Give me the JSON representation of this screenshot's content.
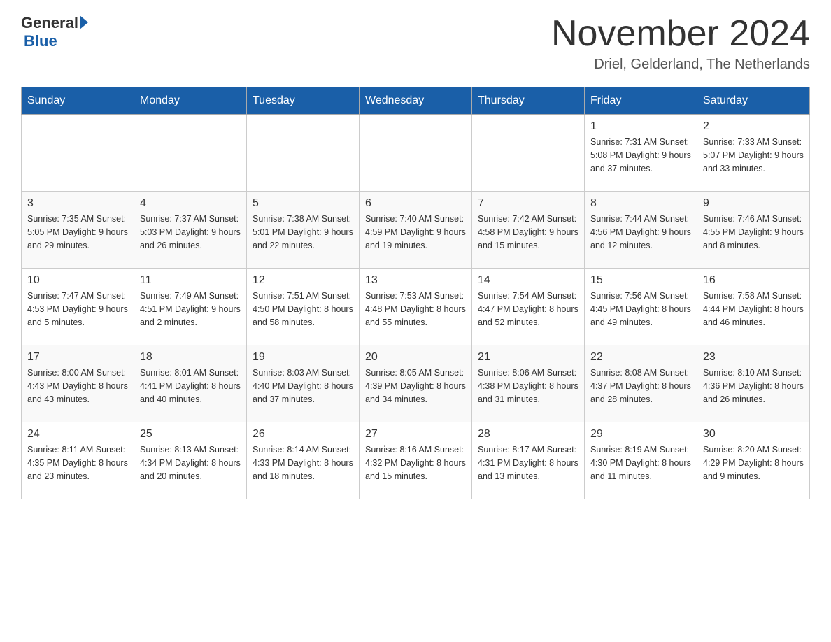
{
  "header": {
    "logo_general": "General",
    "logo_blue": "Blue",
    "month_title": "November 2024",
    "location": "Driel, Gelderland, The Netherlands"
  },
  "weekdays": [
    "Sunday",
    "Monday",
    "Tuesday",
    "Wednesday",
    "Thursday",
    "Friday",
    "Saturday"
  ],
  "weeks": [
    [
      {
        "day": "",
        "info": ""
      },
      {
        "day": "",
        "info": ""
      },
      {
        "day": "",
        "info": ""
      },
      {
        "day": "",
        "info": ""
      },
      {
        "day": "",
        "info": ""
      },
      {
        "day": "1",
        "info": "Sunrise: 7:31 AM\nSunset: 5:08 PM\nDaylight: 9 hours\nand 37 minutes."
      },
      {
        "day": "2",
        "info": "Sunrise: 7:33 AM\nSunset: 5:07 PM\nDaylight: 9 hours\nand 33 minutes."
      }
    ],
    [
      {
        "day": "3",
        "info": "Sunrise: 7:35 AM\nSunset: 5:05 PM\nDaylight: 9 hours\nand 29 minutes."
      },
      {
        "day": "4",
        "info": "Sunrise: 7:37 AM\nSunset: 5:03 PM\nDaylight: 9 hours\nand 26 minutes."
      },
      {
        "day": "5",
        "info": "Sunrise: 7:38 AM\nSunset: 5:01 PM\nDaylight: 9 hours\nand 22 minutes."
      },
      {
        "day": "6",
        "info": "Sunrise: 7:40 AM\nSunset: 4:59 PM\nDaylight: 9 hours\nand 19 minutes."
      },
      {
        "day": "7",
        "info": "Sunrise: 7:42 AM\nSunset: 4:58 PM\nDaylight: 9 hours\nand 15 minutes."
      },
      {
        "day": "8",
        "info": "Sunrise: 7:44 AM\nSunset: 4:56 PM\nDaylight: 9 hours\nand 12 minutes."
      },
      {
        "day": "9",
        "info": "Sunrise: 7:46 AM\nSunset: 4:55 PM\nDaylight: 9 hours\nand 8 minutes."
      }
    ],
    [
      {
        "day": "10",
        "info": "Sunrise: 7:47 AM\nSunset: 4:53 PM\nDaylight: 9 hours\nand 5 minutes."
      },
      {
        "day": "11",
        "info": "Sunrise: 7:49 AM\nSunset: 4:51 PM\nDaylight: 9 hours\nand 2 minutes."
      },
      {
        "day": "12",
        "info": "Sunrise: 7:51 AM\nSunset: 4:50 PM\nDaylight: 8 hours\nand 58 minutes."
      },
      {
        "day": "13",
        "info": "Sunrise: 7:53 AM\nSunset: 4:48 PM\nDaylight: 8 hours\nand 55 minutes."
      },
      {
        "day": "14",
        "info": "Sunrise: 7:54 AM\nSunset: 4:47 PM\nDaylight: 8 hours\nand 52 minutes."
      },
      {
        "day": "15",
        "info": "Sunrise: 7:56 AM\nSunset: 4:45 PM\nDaylight: 8 hours\nand 49 minutes."
      },
      {
        "day": "16",
        "info": "Sunrise: 7:58 AM\nSunset: 4:44 PM\nDaylight: 8 hours\nand 46 minutes."
      }
    ],
    [
      {
        "day": "17",
        "info": "Sunrise: 8:00 AM\nSunset: 4:43 PM\nDaylight: 8 hours\nand 43 minutes."
      },
      {
        "day": "18",
        "info": "Sunrise: 8:01 AM\nSunset: 4:41 PM\nDaylight: 8 hours\nand 40 minutes."
      },
      {
        "day": "19",
        "info": "Sunrise: 8:03 AM\nSunset: 4:40 PM\nDaylight: 8 hours\nand 37 minutes."
      },
      {
        "day": "20",
        "info": "Sunrise: 8:05 AM\nSunset: 4:39 PM\nDaylight: 8 hours\nand 34 minutes."
      },
      {
        "day": "21",
        "info": "Sunrise: 8:06 AM\nSunset: 4:38 PM\nDaylight: 8 hours\nand 31 minutes."
      },
      {
        "day": "22",
        "info": "Sunrise: 8:08 AM\nSunset: 4:37 PM\nDaylight: 8 hours\nand 28 minutes."
      },
      {
        "day": "23",
        "info": "Sunrise: 8:10 AM\nSunset: 4:36 PM\nDaylight: 8 hours\nand 26 minutes."
      }
    ],
    [
      {
        "day": "24",
        "info": "Sunrise: 8:11 AM\nSunset: 4:35 PM\nDaylight: 8 hours\nand 23 minutes."
      },
      {
        "day": "25",
        "info": "Sunrise: 8:13 AM\nSunset: 4:34 PM\nDaylight: 8 hours\nand 20 minutes."
      },
      {
        "day": "26",
        "info": "Sunrise: 8:14 AM\nSunset: 4:33 PM\nDaylight: 8 hours\nand 18 minutes."
      },
      {
        "day": "27",
        "info": "Sunrise: 8:16 AM\nSunset: 4:32 PM\nDaylight: 8 hours\nand 15 minutes."
      },
      {
        "day": "28",
        "info": "Sunrise: 8:17 AM\nSunset: 4:31 PM\nDaylight: 8 hours\nand 13 minutes."
      },
      {
        "day": "29",
        "info": "Sunrise: 8:19 AM\nSunset: 4:30 PM\nDaylight: 8 hours\nand 11 minutes."
      },
      {
        "day": "30",
        "info": "Sunrise: 8:20 AM\nSunset: 4:29 PM\nDaylight: 8 hours\nand 9 minutes."
      }
    ]
  ]
}
